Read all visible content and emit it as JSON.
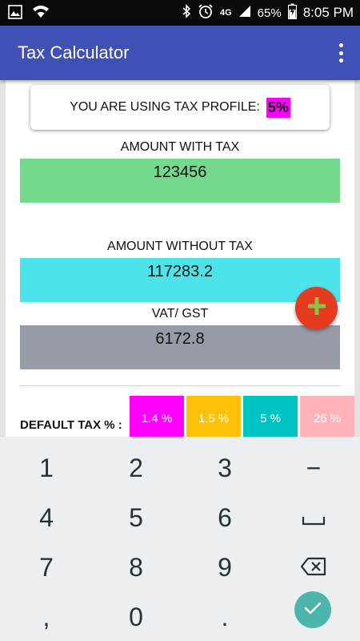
{
  "status_bar": {
    "network": "4G",
    "battery": "65%",
    "time": "8:05 PM"
  },
  "app_bar": {
    "title": "Tax Calculator"
  },
  "profile": {
    "label": "YOU ARE USING TAX PROFILE:",
    "value": "5%",
    "value_color": "#ff00ff"
  },
  "fields": {
    "with_tax": {
      "label": "AMOUNT WITH TAX",
      "value": "123456",
      "color": "#74d98a"
    },
    "without_tax": {
      "label": "AMOUNT WITHOUT TAX",
      "value": "117283.2",
      "color": "#4de3ea"
    },
    "vat": {
      "label": "VAT/ GST",
      "value": "6172.8",
      "color": "#969ba5"
    }
  },
  "default_tax": {
    "label": "DEFAULT TAX % :",
    "chips": [
      {
        "label": "1.4 %",
        "color": "#ff00ff"
      },
      {
        "label": "1.5 %",
        "color": "#ffc107"
      },
      {
        "label": "5 %",
        "color": "#00c4c4"
      },
      {
        "label": "26 %",
        "color": "#ffb3b8"
      }
    ]
  },
  "keyboard": {
    "keys": [
      "1",
      "2",
      "3",
      "−",
      "4",
      "5",
      "6",
      "␣",
      "7",
      "8",
      "9",
      "⌫",
      ",",
      "0",
      ".",
      "✓"
    ],
    "accent": "#4db6ac"
  },
  "colors": {
    "app_bar": "#3f51b5",
    "fab": "#e53a1e",
    "fab_icon": "#8bc34a"
  }
}
